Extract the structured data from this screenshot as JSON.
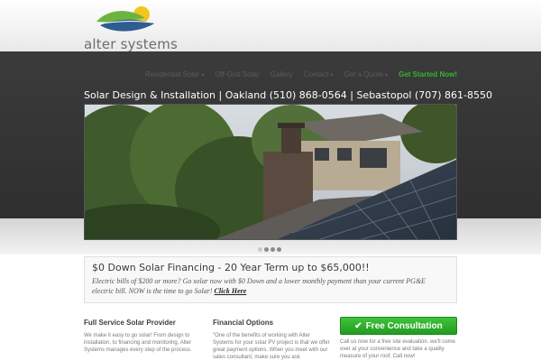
{
  "brand": {
    "name": "alter systems"
  },
  "colors": {
    "accent_green": "#35b52c",
    "dark_band": "#353535",
    "leaf_green": "#6db33f",
    "leaf_blue": "#2e5d8f",
    "sun": "#f3c520"
  },
  "nav": {
    "items": [
      {
        "label": "Residential Solar",
        "has_dropdown": true
      },
      {
        "label": "Off-Grid Solar",
        "has_dropdown": false
      },
      {
        "label": "Gallery",
        "has_dropdown": false
      },
      {
        "label": "Contact",
        "has_dropdown": true
      },
      {
        "label": "Get a Quote",
        "has_dropdown": true
      }
    ],
    "cta": "Get Started Now!"
  },
  "tagline": "Solar Design & Installation | Oakland (510) 868-0564 | Sebastopol (707) 861-8550",
  "slider": {
    "dot_count": 4,
    "active_index": 0
  },
  "promo": {
    "title": "$0 Down Solar Financing - 20 Year Term up to $65,000!!",
    "text": "Electric bills of $200 or more? Go solar now with $0 Down and a lower monthly payment than your current PG&E electric bill. NOW is the time to go Solar!",
    "link": "Click Here"
  },
  "columns": [
    {
      "title": "Full Service Solar Provider",
      "text": "We make it easy to go solar! From design to installation, to financing and monitoring, Alter Systems manages every step of the process."
    },
    {
      "title": "Financial Options",
      "text": "\"One of the benefits of working with Alter Systems for your solar PV project is that we offer great payment options. When you meet with our sales consultant, make sure you ask"
    }
  ],
  "consultation": {
    "button": "Free Consultation",
    "icon": "check-icon",
    "text": "Call us now for a free site evaluation. we'll come over at your convenience and take a quality measure of your roof. Call now!"
  }
}
